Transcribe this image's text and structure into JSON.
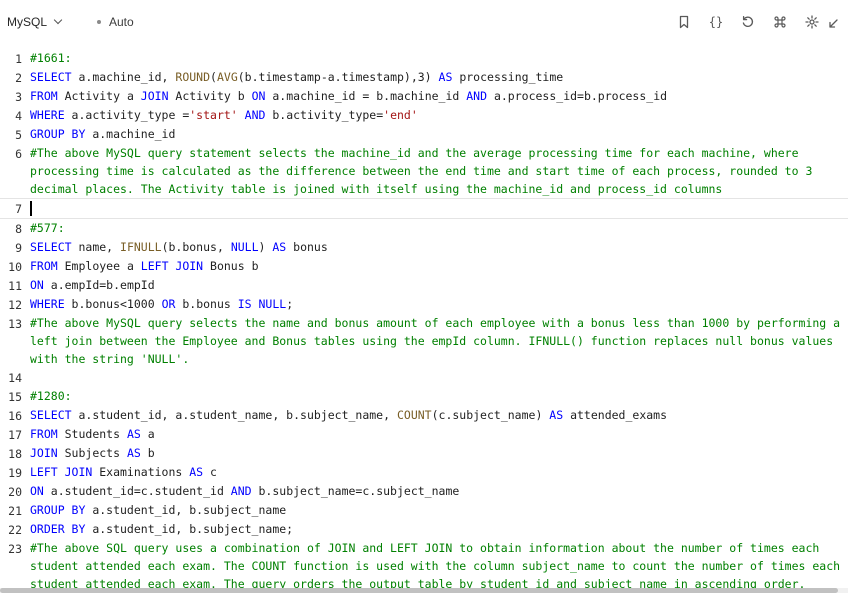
{
  "toolbar": {
    "language": "MySQL",
    "mode": "Auto",
    "icons": [
      "bookmark-icon",
      "braces-icon",
      "reset-icon",
      "shortcut-icon",
      "settings-icon",
      "expand-icon"
    ]
  },
  "lines": [
    {
      "n": "1",
      "t": [
        [
          "c",
          "#1661:"
        ]
      ]
    },
    {
      "n": "2",
      "t": [
        [
          "k",
          "SELECT"
        ],
        [
          "p",
          " a.machine_id, "
        ],
        [
          "f",
          "ROUND"
        ],
        [
          "p",
          "("
        ],
        [
          "f",
          "AVG"
        ],
        [
          "p",
          "(b.timestamp-a.timestamp),3) "
        ],
        [
          "k",
          "AS"
        ],
        [
          "p",
          " processing_time"
        ]
      ]
    },
    {
      "n": "3",
      "t": [
        [
          "k",
          "FROM"
        ],
        [
          "p",
          " Activity a "
        ],
        [
          "k",
          "JOIN"
        ],
        [
          "p",
          " Activity b "
        ],
        [
          "k",
          "ON"
        ],
        [
          "p",
          " a.machine_id = b.machine_id "
        ],
        [
          "k",
          "AND"
        ],
        [
          "p",
          " a.process_id=b.process_id"
        ]
      ]
    },
    {
      "n": "4",
      "t": [
        [
          "k",
          "WHERE"
        ],
        [
          "p",
          " a.activity_type ="
        ],
        [
          "s",
          "'start'"
        ],
        [
          "p",
          " "
        ],
        [
          "k",
          "AND"
        ],
        [
          "p",
          " b.activity_type="
        ],
        [
          "s",
          "'end'"
        ]
      ]
    },
    {
      "n": "5",
      "t": [
        [
          "k",
          "GROUP BY"
        ],
        [
          "p",
          " a.machine_id"
        ]
      ]
    },
    {
      "n": "6",
      "t": [
        [
          "c",
          "#The above MySQL query statement selects the machine_id and the average processing time for each machine, where processing time is calculated as the difference between the end time and start time of each process, rounded to 3 decimal places. The Activity table is joined with itself using the machine_id and process_id columns"
        ]
      ]
    },
    {
      "n": "7",
      "t": [],
      "active": true
    },
    {
      "n": "8",
      "t": [
        [
          "c",
          "#577:"
        ]
      ]
    },
    {
      "n": "9",
      "t": [
        [
          "k",
          "SELECT"
        ],
        [
          "p",
          " name, "
        ],
        [
          "f",
          "IFNULL"
        ],
        [
          "p",
          "(b.bonus, "
        ],
        [
          "k",
          "NULL"
        ],
        [
          "p",
          ") "
        ],
        [
          "k",
          "AS"
        ],
        [
          "p",
          " bonus"
        ]
      ]
    },
    {
      "n": "10",
      "t": [
        [
          "k",
          "FROM"
        ],
        [
          "p",
          " Employee a "
        ],
        [
          "k",
          "LEFT JOIN"
        ],
        [
          "p",
          " Bonus b"
        ]
      ]
    },
    {
      "n": "11",
      "t": [
        [
          "k",
          "ON"
        ],
        [
          "p",
          " a.empId=b.empId"
        ]
      ]
    },
    {
      "n": "12",
      "t": [
        [
          "k",
          "WHERE"
        ],
        [
          "p",
          " b.bonus<1000 "
        ],
        [
          "k",
          "OR"
        ],
        [
          "p",
          " b.bonus "
        ],
        [
          "k",
          "IS NULL"
        ],
        [
          "p",
          ";"
        ]
      ]
    },
    {
      "n": "13",
      "t": [
        [
          "c",
          "#The above MySQL query selects the name and bonus amount of each employee with a bonus less than 1000 by performing a left join between the Employee and Bonus tables using the empId column. IFNULL() function replaces null bonus values with the string 'NULL'."
        ]
      ]
    },
    {
      "n": "14",
      "t": []
    },
    {
      "n": "15",
      "t": [
        [
          "c",
          "#1280:"
        ]
      ]
    },
    {
      "n": "16",
      "t": [
        [
          "k",
          "SELECT"
        ],
        [
          "p",
          " a.student_id, a.student_name, b.subject_name, "
        ],
        [
          "f",
          "COUNT"
        ],
        [
          "p",
          "(c.subject_name) "
        ],
        [
          "k",
          "AS"
        ],
        [
          "p",
          " attended_exams"
        ]
      ]
    },
    {
      "n": "17",
      "t": [
        [
          "k",
          "FROM"
        ],
        [
          "p",
          " Students "
        ],
        [
          "k",
          "AS"
        ],
        [
          "p",
          " a"
        ]
      ]
    },
    {
      "n": "18",
      "t": [
        [
          "k",
          "JOIN"
        ],
        [
          "p",
          " Subjects "
        ],
        [
          "k",
          "AS"
        ],
        [
          "p",
          " b"
        ]
      ]
    },
    {
      "n": "19",
      "t": [
        [
          "k",
          "LEFT JOIN"
        ],
        [
          "p",
          " Examinations "
        ],
        [
          "k",
          "AS"
        ],
        [
          "p",
          " c"
        ]
      ]
    },
    {
      "n": "20",
      "t": [
        [
          "k",
          "ON"
        ],
        [
          "p",
          " a.student_id=c.student_id "
        ],
        [
          "k",
          "AND"
        ],
        [
          "p",
          " b.subject_name=c.subject_name"
        ]
      ]
    },
    {
      "n": "21",
      "t": [
        [
          "k",
          "GROUP BY"
        ],
        [
          "p",
          " a.student_id, b.subject_name"
        ]
      ]
    },
    {
      "n": "22",
      "t": [
        [
          "k",
          "ORDER BY"
        ],
        [
          "p",
          " a.student_id, b.subject_name;"
        ]
      ]
    },
    {
      "n": "23",
      "t": [
        [
          "c",
          "#The above SQL query uses a combination of JOIN and LEFT JOIN to obtain information about the number of times each student attended each exam. The COUNT function is used with the column subject_name to count the number of times each student attended each exam. The query orders the output table by student_id and subject_name in ascending order."
        ]
      ]
    }
  ]
}
